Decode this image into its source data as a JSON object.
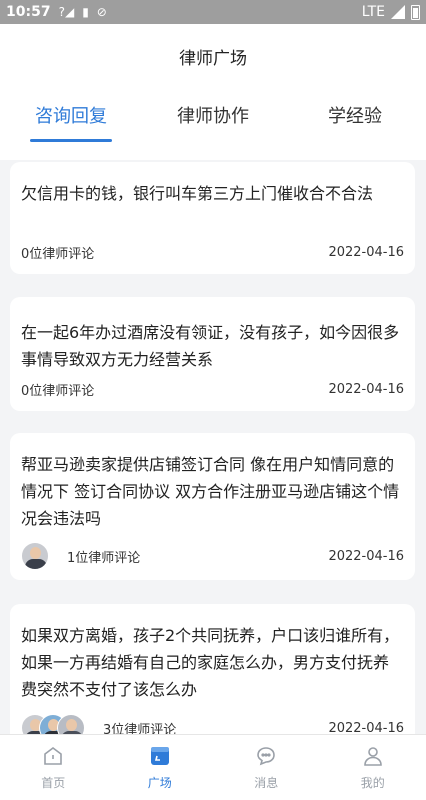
{
  "status_bar": {
    "time": "10:57",
    "network": "LTE"
  },
  "header": {
    "title": "律师广场",
    "tabs": [
      {
        "label": "咨询回复",
        "active": true
      },
      {
        "label": "律师协作",
        "active": false
      },
      {
        "label": "学经验",
        "active": false
      }
    ]
  },
  "questions": [
    {
      "text": "欠信用卡的钱，银行叫车第三方上门催收合不合法",
      "comments": "0位律师评论",
      "date": "2022-04-16",
      "avatars": 0
    },
    {
      "text": "在一起6年办过酒席没有领证，没有孩子，如今因很多事情导致双方无力经营关系",
      "comments": "0位律师评论",
      "date": "2022-04-16",
      "avatars": 0
    },
    {
      "text": "帮亚马逊卖家提供店铺签订合同 像在用户知情同意的情况下 签订合同协议 双方合作注册亚马逊店铺这个情况会违法吗",
      "comments": "1位律师评论",
      "date": "2022-04-16",
      "avatars": 1
    },
    {
      "text": "如果双方离婚，孩子2个共同抚养，户口该归谁所有，如果一方再结婚有自己的家庭怎么办，男方支付抚养费突然不支付了该怎么办",
      "comments": "3位律师评论",
      "date": "2022-04-16",
      "avatars": 3
    }
  ],
  "bottom_nav": [
    {
      "label": "首页",
      "icon": "home-icon",
      "active": false
    },
    {
      "label": "广场",
      "icon": "square-icon",
      "active": true
    },
    {
      "label": "消息",
      "icon": "message-icon",
      "active": false
    },
    {
      "label": "我的",
      "icon": "profile-icon",
      "active": false
    }
  ],
  "colors": {
    "accent": "#2f7bd8",
    "background": "#f3f4f6",
    "status_bar": "#9e9e9e"
  }
}
